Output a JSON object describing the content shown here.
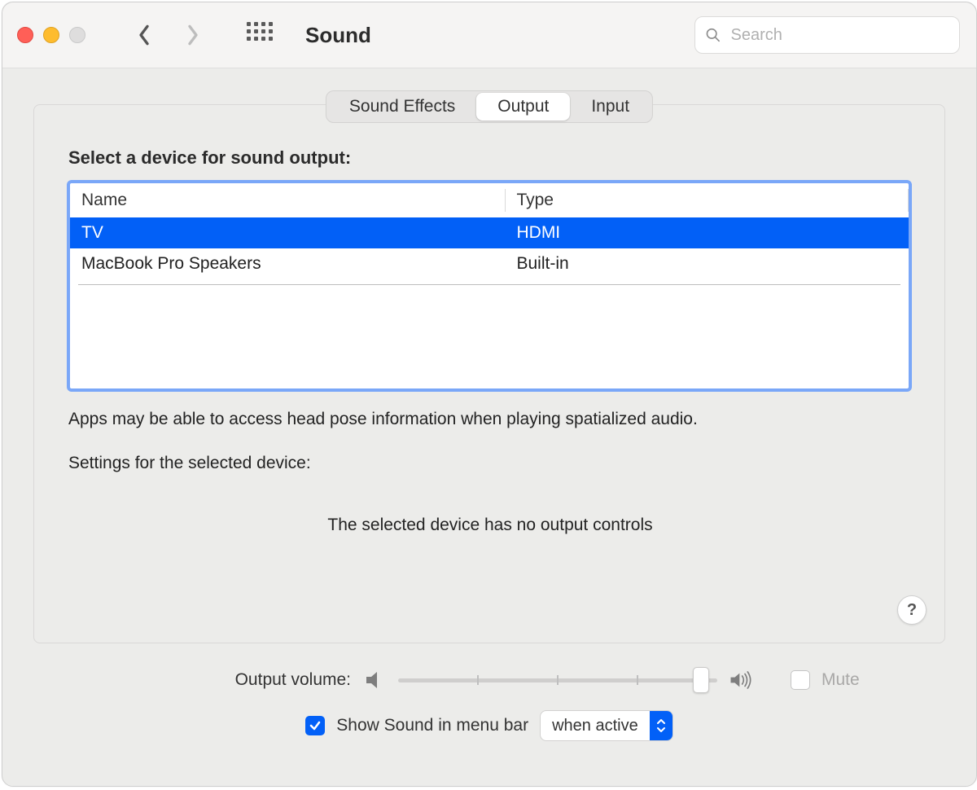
{
  "titlebar": {
    "title": "Sound",
    "search_placeholder": "Search"
  },
  "tabs": [
    {
      "label": "Sound Effects",
      "active": false
    },
    {
      "label": "Output",
      "active": true
    },
    {
      "label": "Input",
      "active": false
    }
  ],
  "section_heading": "Select a device for sound output:",
  "columns": {
    "name": "Name",
    "type": "Type"
  },
  "devices": [
    {
      "name": "TV",
      "type": "HDMI",
      "selected": true
    },
    {
      "name": "MacBook Pro Speakers",
      "type": "Built-in",
      "selected": false
    }
  ],
  "privacy_note": "Apps may be able to access head pose information when playing spatialized audio.",
  "settings_label": "Settings for the selected device:",
  "no_controls_text": "The selected device has no output controls",
  "help_glyph": "?",
  "volume": {
    "label": "Output volume:",
    "value_percent": 95,
    "mute_label": "Mute",
    "mute_checked": false
  },
  "menubar": {
    "checkbox_label": "Show Sound in menu bar",
    "checked": true,
    "select_value": "when active"
  }
}
